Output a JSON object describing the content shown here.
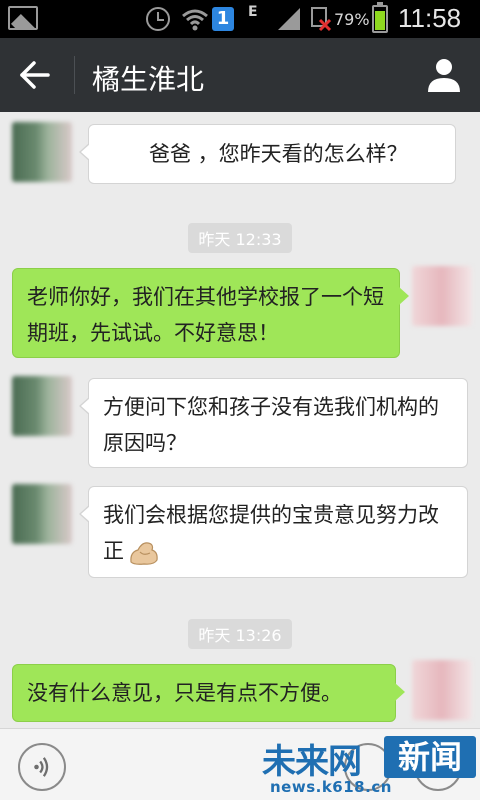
{
  "status_bar": {
    "sim_badge": "1",
    "network": "E",
    "battery_percent": "79%",
    "battery_level": 0.79,
    "time": "11:58"
  },
  "header": {
    "title": "橘生淮北",
    "back_icon": "back-arrow-icon",
    "profile_icon": "person-icon"
  },
  "messages": [
    {
      "id": "m1",
      "direction": "incoming",
      "text": "爸爸 ，您昨天看的怎么样？"
    },
    {
      "id": "t1",
      "type": "timestamp",
      "text": "昨天 12:33"
    },
    {
      "id": "m2",
      "direction": "outgoing",
      "text": "老师你好，我们在其他学校报了一个短期班，先试试。不好意思！"
    },
    {
      "id": "m3",
      "direction": "incoming",
      "text": "方便问下您和孩子没有选我们机构的原因吗？"
    },
    {
      "id": "m4",
      "direction": "incoming",
      "text": "我们会根据您提供的宝贵意见努力改正",
      "emoji": "flexed-biceps-icon"
    },
    {
      "id": "t2",
      "type": "timestamp",
      "text": "昨天 13:26"
    },
    {
      "id": "m5",
      "direction": "outgoing",
      "text": "没有什么意见，只是有点不方便。"
    }
  ],
  "input_bar": {
    "voice_icon": "voice-icon",
    "emoji_icon": "emoji-icon",
    "plus_icon": "plus-icon"
  },
  "watermark": {
    "brand_text": "未来网",
    "badge_text": "新闻",
    "url": "news.k618.cn",
    "color": "#1f6fb2"
  },
  "colors": {
    "outgoing_bubble": "#9fe658",
    "incoming_bubble": "#ffffff",
    "titlebar": "#2f3235",
    "background": "#ebebeb"
  }
}
